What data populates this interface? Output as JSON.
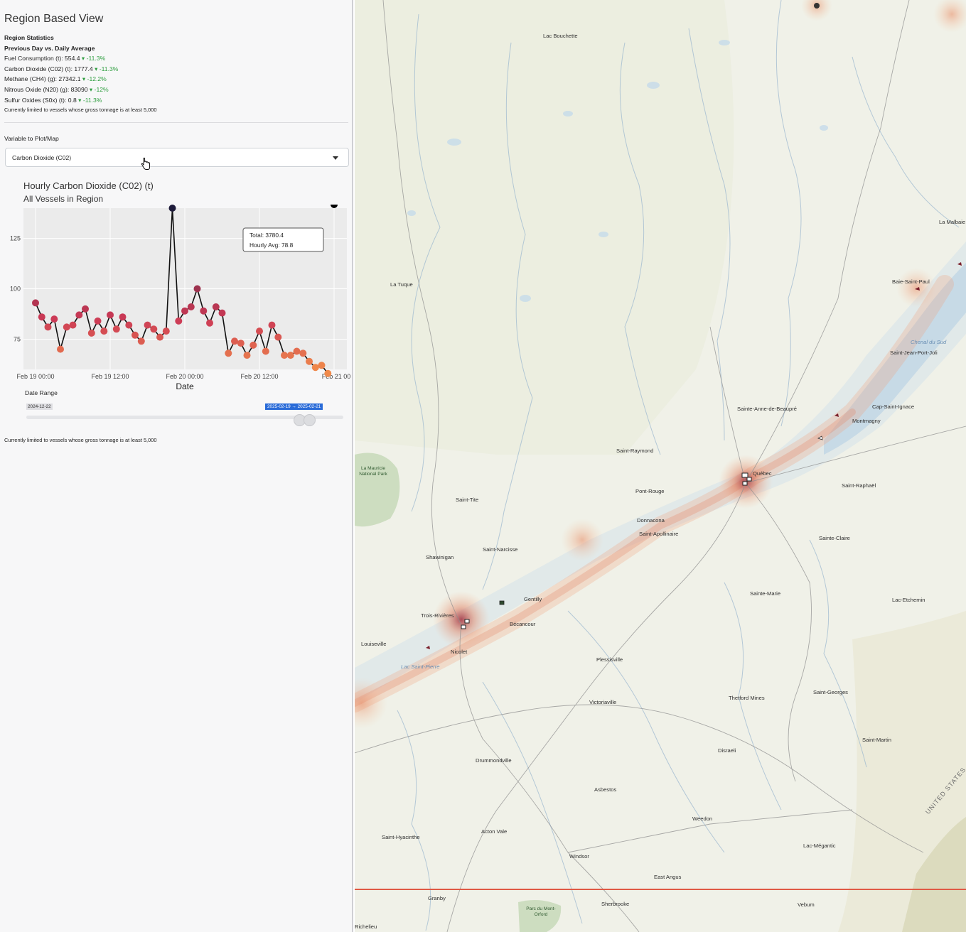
{
  "sidebar": {
    "title": "Region Based View",
    "stats": {
      "heading": "Region Statistics",
      "subheading": "Previous Day vs. Daily Average",
      "rows": [
        {
          "label": "Fuel Consumption (t): 554.4",
          "change": "-11.3%"
        },
        {
          "label": "Carbon Dioxide (C02) (t): 1777.4",
          "change": "-11.3%"
        },
        {
          "label": "Methane (CH4) (g): 27342.1",
          "change": "-12.2%"
        },
        {
          "label": "Nitrous Oxide (N20) (g): 83090",
          "change": "-12%"
        },
        {
          "label": "Sulfur Oxides (S0x) (t): 0.8",
          "change": "-11.3%"
        }
      ],
      "note": "Currently limited to vessels whose gross tonnage is at least 5,000"
    },
    "variable_label": "Variable to Plot/Map",
    "variable_selected": "Carbon Dioxide (C02)",
    "chart_title": "Hourly Carbon Dioxide (C02) (t)",
    "chart_subtitle": "All Vessels in Region",
    "tooltip": {
      "total": "Total: 3780.4",
      "avg": "Hourly Avg: 78.8"
    },
    "date_range_label": "Date Range",
    "date_range_min": "2024-12-22",
    "date_range_selected": "2025-02-19 → 2025-02-21",
    "bottom_note": "Currently limited to vessels whose gross tonnage is at least 5,000"
  },
  "chart_data": {
    "type": "line",
    "xlabel": "Date",
    "ylabel": "",
    "x_ticks": [
      "Feb 19 00:00",
      "Feb 19 12:00",
      "Feb 20 00:00",
      "Feb 20 12:00",
      "Feb 21 00"
    ],
    "y_ticks": [
      75,
      100,
      125
    ],
    "ylim": [
      60,
      140
    ],
    "grid": true,
    "x_hours": [
      0,
      1,
      2,
      3,
      4,
      5,
      6,
      7,
      8,
      9,
      10,
      11,
      12,
      13,
      14,
      15,
      16,
      17,
      18,
      19,
      20,
      21,
      22,
      23,
      24,
      25,
      26,
      27,
      28,
      29,
      30,
      31,
      32,
      33,
      34,
      35,
      36,
      37,
      38,
      39,
      40,
      41,
      42,
      43,
      44,
      45,
      46,
      47,
      48
    ],
    "values": [
      93,
      86,
      81,
      85,
      70,
      81,
      82,
      87,
      90,
      78,
      84,
      79,
      87,
      80,
      86,
      82,
      77,
      74,
      82,
      80,
      76,
      79,
      140,
      84,
      89,
      91,
      100,
      89,
      83,
      91,
      88,
      68,
      74,
      73,
      67,
      72,
      79,
      69,
      82,
      76,
      67,
      67,
      69,
      68,
      64,
      61,
      62,
      58
    ],
    "colors": {
      "low": "#f08a4b",
      "mid": "#cc3a56",
      "high": "#1e1b3a",
      "line": "#111111",
      "panel": "#ebebeb"
    }
  },
  "map": {
    "places": [
      {
        "name": "Lac Bouchette",
        "kind": "town"
      },
      {
        "name": "La Tuque",
        "kind": "town"
      },
      {
        "name": "Baie-Saint-Paul",
        "kind": "town"
      },
      {
        "name": "La Malbaie",
        "kind": "town"
      },
      {
        "name": "Saint-Jean-Port-Joli",
        "kind": "town"
      },
      {
        "name": "Chenal du Sud",
        "kind": "water"
      },
      {
        "name": "Cap-Saint-Ignace",
        "kind": "town"
      },
      {
        "name": "Montmagny",
        "kind": "town"
      },
      {
        "name": "Sainte-Anne-de-Beaupré",
        "kind": "town"
      },
      {
        "name": "Saint-Raymond",
        "kind": "town"
      },
      {
        "name": "Pont-Rouge",
        "kind": "town"
      },
      {
        "name": "Donnacona",
        "kind": "town"
      },
      {
        "name": "Saint-Apollinaire",
        "kind": "town"
      },
      {
        "name": "Saint-Raphaël",
        "kind": "town"
      },
      {
        "name": "Sainte-Claire",
        "kind": "town"
      },
      {
        "name": "Saint-Tite",
        "kind": "town"
      },
      {
        "name": "Saint-Narcisse",
        "kind": "town"
      },
      {
        "name": "Shawinigan",
        "kind": "town"
      },
      {
        "name": "Gentilly",
        "kind": "town"
      },
      {
        "name": "Trois-Rivières",
        "kind": "town"
      },
      {
        "name": "Bécancour",
        "kind": "town"
      },
      {
        "name": "Louiseville",
        "kind": "town"
      },
      {
        "name": "Nicolet",
        "kind": "town"
      },
      {
        "name": "Lac Saint-Pierre",
        "kind": "water"
      },
      {
        "name": "Plessisville",
        "kind": "town"
      },
      {
        "name": "Victoriaville",
        "kind": "town"
      },
      {
        "name": "Sainte-Marie",
        "kind": "town"
      },
      {
        "name": "Lac-Etchemin",
        "kind": "town"
      },
      {
        "name": "Thetford Mines",
        "kind": "town"
      },
      {
        "name": "Saint-Georges",
        "kind": "town"
      },
      {
        "name": "Saint-Martin",
        "kind": "town"
      },
      {
        "name": "Drummondville",
        "kind": "town"
      },
      {
        "name": "Asbestos",
        "kind": "town"
      },
      {
        "name": "Disraeli",
        "kind": "town"
      },
      {
        "name": "Weedon",
        "kind": "town"
      },
      {
        "name": "Saint-Hyacinthe",
        "kind": "town"
      },
      {
        "name": "Acton Vale",
        "kind": "town"
      },
      {
        "name": "Windsor",
        "kind": "town"
      },
      {
        "name": "Lac-Mégantic",
        "kind": "town"
      },
      {
        "name": "East Angus",
        "kind": "town"
      },
      {
        "name": "Granby",
        "kind": "town"
      },
      {
        "name": "Sherbrooke",
        "kind": "town"
      },
      {
        "name": "Vebum",
        "kind": "town"
      },
      {
        "name": "Richelieu",
        "kind": "town"
      },
      {
        "name": "Québec",
        "kind": "town"
      },
      {
        "name": "UNITED STATES",
        "kind": "country"
      },
      {
        "name": "La Mauricie National Park",
        "kind": "park"
      },
      {
        "name": "Parc du Mont-Orford",
        "kind": "park"
      }
    ]
  }
}
